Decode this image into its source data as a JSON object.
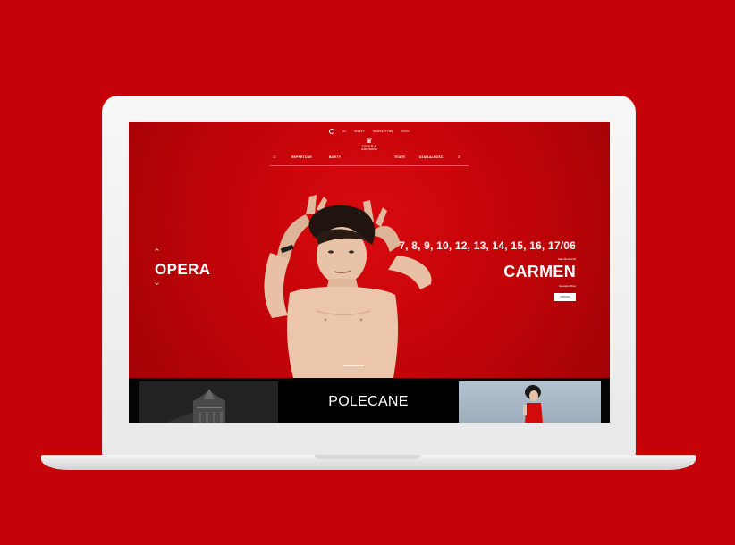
{
  "top_links": [
    "PL",
    "BILETY",
    "NEWSLETTER",
    "FOTO"
  ],
  "logo": {
    "title": "OPERA",
    "subtitle": "NARODOWA"
  },
  "nav": {
    "items": [
      "REPERTUAR",
      "BILETY",
      "TEATR",
      "DZIAŁALNOŚĆ"
    ]
  },
  "hero": {
    "category": "OPERA",
    "dates": "7, 8, 9, 10, 12, 13, 14, 15, 16, 17/06",
    "small_above": "Sala Moniuszki",
    "title": "CARMEN",
    "composer": "Georges Bizet",
    "more_button": "WIĘCEJ"
  },
  "strip": {
    "middle_label": "POLECANE"
  },
  "colors": {
    "background": "#c50207",
    "hero_red": "#c00408"
  }
}
